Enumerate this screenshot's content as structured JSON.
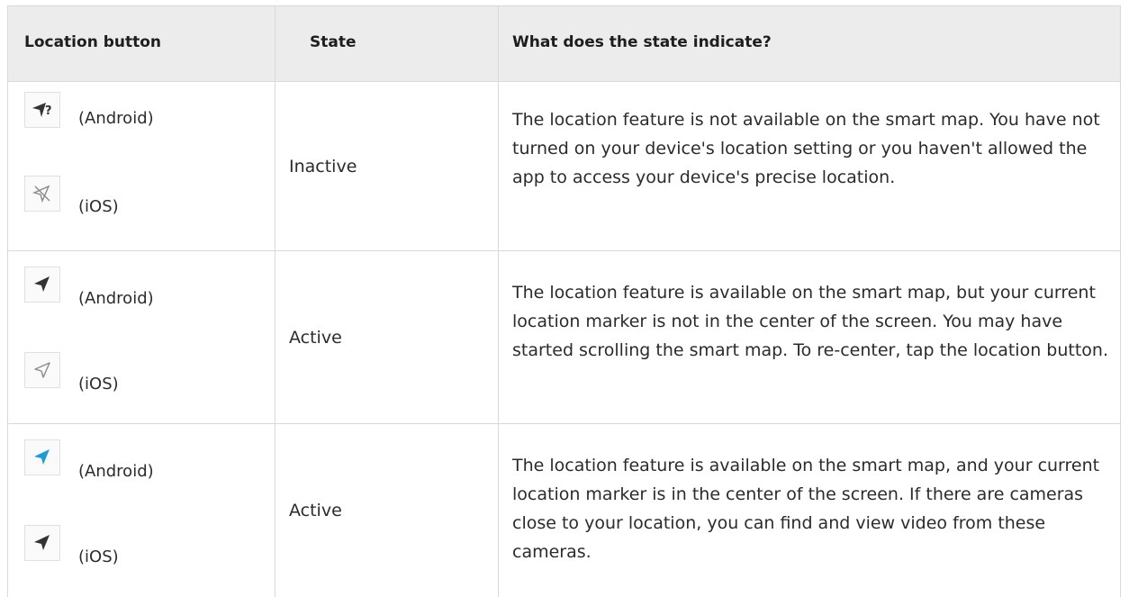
{
  "headers": {
    "button": "Location button",
    "state": "State",
    "meaning": "What does the state indicate?"
  },
  "rows": [
    {
      "android_icon": "location-disabled-question-icon",
      "android_label": "(Android)",
      "ios_icon": "location-crossed-icon",
      "ios_label": "(iOS)",
      "state": "Inactive",
      "description": "The location feature is not available on the smart map. You have not turned on your device's location setting or you haven't allowed the app to access your device's precise location."
    },
    {
      "android_icon": "location-arrow-filled-dark-icon",
      "android_label": "(Android)",
      "ios_icon": "location-arrow-outline-icon",
      "ios_label": "(iOS)",
      "state": "Active",
      "description": "The location feature is available on the smart map, but your current location marker is not in the center of the screen. You may have started scrolling the smart map. To re-center, tap the location button."
    },
    {
      "android_icon": "location-arrow-filled-blue-icon",
      "android_label": "(Android)",
      "ios_icon": "location-arrow-filled-dark-icon",
      "ios_label": "(iOS)",
      "state": "Active",
      "description": "The location feature is available on the smart map, and your current location marker is in the center of the screen. If there are cameras close to your location, you can find and view video from these cameras."
    }
  ],
  "colors": {
    "header_bg": "#ececec",
    "border": "#d9d9d9",
    "arrow_dark": "#333333",
    "arrow_blue": "#1e9ad6"
  }
}
